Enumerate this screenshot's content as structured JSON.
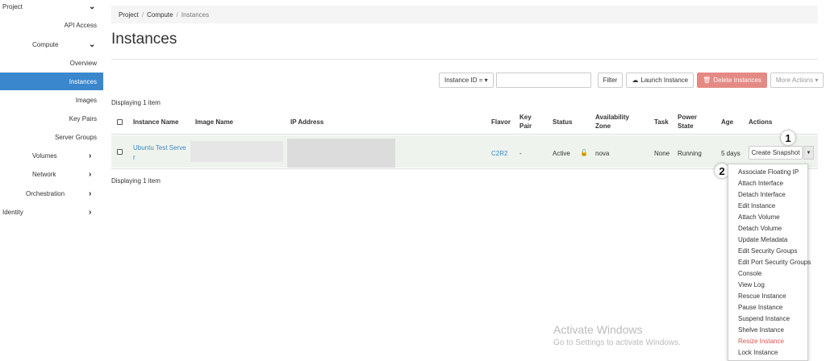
{
  "sidebar": {
    "items": [
      {
        "label": "Project",
        "chevron": "⌄"
      },
      {
        "label": "API Access"
      },
      {
        "label": "Compute",
        "chevron": "⌄"
      },
      {
        "label": "Overview"
      },
      {
        "label": "Instances"
      },
      {
        "label": "Images"
      },
      {
        "label": "Key Pairs"
      },
      {
        "label": "Server Groups"
      },
      {
        "label": "Volumes",
        "chevron": "›"
      },
      {
        "label": "Network",
        "chevron": "›"
      },
      {
        "label": "Orchestration",
        "chevron": "›"
      },
      {
        "label": "Identity",
        "chevron": "›"
      }
    ]
  },
  "breadcrumb": {
    "project": "Project",
    "sep": "/",
    "compute": "Compute",
    "current": "Instances"
  },
  "page_title": "Instances",
  "toolbar": {
    "filter_select": "Instance ID = ▾",
    "filter_input": "",
    "filter_button": "Filter",
    "launch_icon": "cloud-upload-icon",
    "launch_button": "Launch Instance",
    "delete_icon": "trash-icon",
    "delete_button": "Delete Instances",
    "more_actions": "More Actions ▾"
  },
  "displaying": "Displaying 1 item",
  "table": {
    "headers": {
      "name": "Instance Name",
      "image": "Image Name",
      "ip": "IP Address",
      "flavor": "Flavor",
      "keypair": "Key Pair",
      "status": "Status",
      "az": "Availability Zone",
      "task": "Task",
      "power": "Power State",
      "age": "Age",
      "actions": "Actions"
    },
    "rows": [
      {
        "name_line1": "Ubuntu Test Serve",
        "name_line2": "r",
        "image": "",
        "ip": "",
        "flavor": "C2R2",
        "keypair": "-",
        "status": "Active",
        "lock_icon": "unlock-icon",
        "az": "nova",
        "task": "None",
        "power": "Running",
        "age": "5 days",
        "action": "Create Snapshot"
      }
    ]
  },
  "badges": {
    "one": "1",
    "two": "2"
  },
  "menu": {
    "items": [
      "Associate Floating IP",
      "Attach Interface",
      "Detach Interface",
      "Edit Instance",
      "Attach Volume",
      "Detach Volume",
      "Update Metadata",
      "Edit Security Groups",
      "Edit Port Security Groups",
      "Console",
      "View Log",
      "Rescue Instance",
      "Pause Instance",
      "Suspend Instance",
      "Shelve Instance",
      "Resize Instance",
      "Lock Instance"
    ]
  },
  "watermark": {
    "line1": "Activate Windows",
    "line2": "Go to Settings to activate Windows."
  },
  "colors": {
    "accent": "#3a87cd",
    "danger": "#e48a84",
    "row_bg": "#eef4ed"
  }
}
